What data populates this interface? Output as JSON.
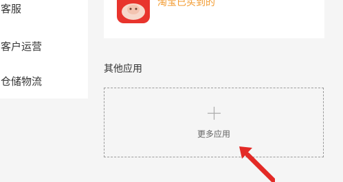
{
  "sidebar": {
    "items": [
      {
        "label": "客服"
      },
      {
        "label": "客户运营"
      },
      {
        "label": "仓储物流"
      }
    ]
  },
  "installed_app": {
    "name": "淘宝已买到的"
  },
  "other_apps": {
    "title": "其他应用",
    "more_label": "更多应用"
  },
  "colors": {
    "app_icon": "#e8342d",
    "app_name": "#f29a2e",
    "arrow": "#e32a26"
  }
}
